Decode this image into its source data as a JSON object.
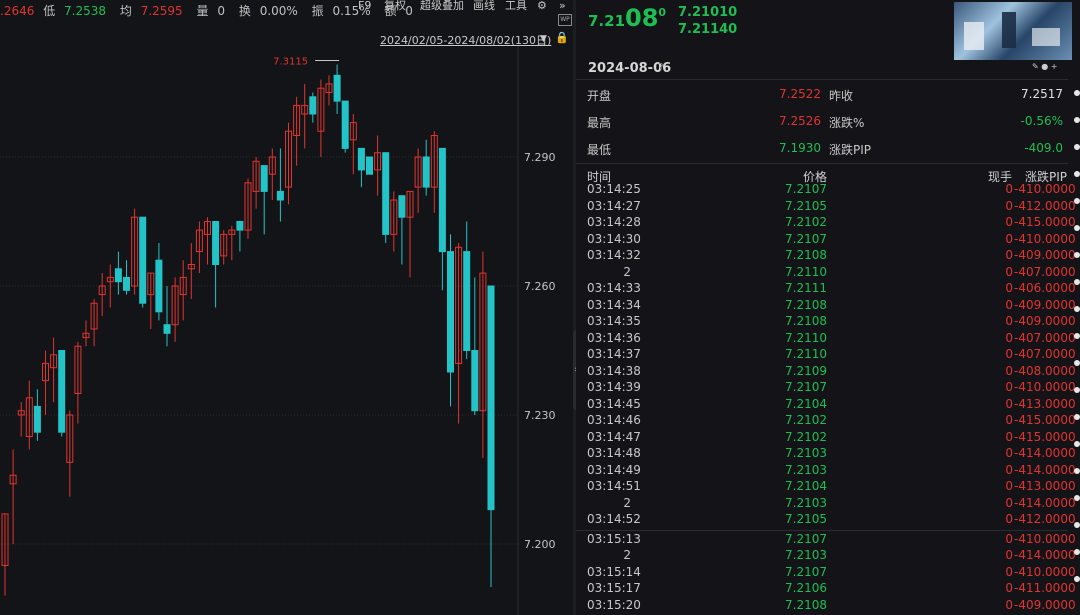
{
  "statbar": {
    "close_tail": ".2646",
    "low_label": "低",
    "low_value": "7.2538",
    "avg_label": "均",
    "avg_value": "7.2595",
    "vol_label": "量",
    "vol_value": "0",
    "turnover_label": "换",
    "turnover_value": "0.00%",
    "amplitude_label": "振",
    "amplitude_value": "0.15%",
    "amount_label": "额",
    "amount_value": "0"
  },
  "toolbar": {
    "f9": "F9",
    "restore": "复权",
    "overlay": "超级叠加",
    "drawline": "画线",
    "tools": "工具",
    "icon_badge": "WP"
  },
  "chart_header": {
    "range": "2024/02/05-2024/08/02(130日)"
  },
  "chart_data": {
    "type": "candlestick",
    "y_axis_ticks": [
      "7.290",
      "7.260",
      "7.230",
      "7.200"
    ],
    "y_tick_values": [
      7.29,
      7.26,
      7.23,
      7.2
    ],
    "max_annotation": "7.3115",
    "max_value": 7.3115,
    "colors": {
      "up": "#e0342f",
      "down": "#22c4c8",
      "grid": "#2a2c33"
    },
    "candles": [
      {
        "o": 7.195,
        "h": 7.205,
        "l": 7.188,
        "c": 7.207
      },
      {
        "o": 7.214,
        "h": 7.222,
        "l": 7.2,
        "c": 7.216
      },
      {
        "o": 7.23,
        "h": 7.233,
        "l": 7.225,
        "c": 7.231
      },
      {
        "o": 7.225,
        "h": 7.238,
        "l": 7.222,
        "c": 7.234
      },
      {
        "o": 7.232,
        "h": 7.236,
        "l": 7.224,
        "c": 7.226
      },
      {
        "o": 7.238,
        "h": 7.245,
        "l": 7.23,
        "c": 7.242
      },
      {
        "o": 7.241,
        "h": 7.248,
        "l": 7.233,
        "c": 7.244
      },
      {
        "o": 7.245,
        "h": 7.24,
        "l": 7.225,
        "c": 7.226
      },
      {
        "o": 7.219,
        "h": 7.231,
        "l": 7.211,
        "c": 7.23
      },
      {
        "o": 7.235,
        "h": 7.247,
        "l": 7.228,
        "c": 7.246
      },
      {
        "o": 7.248,
        "h": 7.252,
        "l": 7.246,
        "c": 7.249
      },
      {
        "o": 7.25,
        "h": 7.257,
        "l": 7.246,
        "c": 7.256
      },
      {
        "o": 7.258,
        "h": 7.263,
        "l": 7.253,
        "c": 7.26
      },
      {
        "o": 7.261,
        "h": 7.265,
        "l": 7.255,
        "c": 7.262
      },
      {
        "o": 7.264,
        "h": 7.268,
        "l": 7.258,
        "c": 7.261
      },
      {
        "o": 7.262,
        "h": 7.266,
        "l": 7.258,
        "c": 7.259
      },
      {
        "o": 7.26,
        "h": 7.278,
        "l": 7.258,
        "c": 7.276
      },
      {
        "o": 7.276,
        "h": 7.27,
        "l": 7.255,
        "c": 7.256
      },
      {
        "o": 7.258,
        "h": 7.262,
        "l": 7.25,
        "c": 7.263
      },
      {
        "o": 7.266,
        "h": 7.27,
        "l": 7.252,
        "c": 7.254
      },
      {
        "o": 7.251,
        "h": 7.26,
        "l": 7.246,
        "c": 7.249
      },
      {
        "o": 7.251,
        "h": 7.262,
        "l": 7.247,
        "c": 7.26
      },
      {
        "o": 7.258,
        "h": 7.266,
        "l": 7.252,
        "c": 7.262
      },
      {
        "o": 7.264,
        "h": 7.27,
        "l": 7.257,
        "c": 7.265
      },
      {
        "o": 7.268,
        "h": 7.275,
        "l": 7.263,
        "c": 7.273
      },
      {
        "o": 7.272,
        "h": 7.276,
        "l": 7.265,
        "c": 7.275
      },
      {
        "o": 7.275,
        "h": 7.266,
        "l": 7.255,
        "c": 7.265
      },
      {
        "o": 7.267,
        "h": 7.273,
        "l": 7.265,
        "c": 7.272
      },
      {
        "o": 7.272,
        "h": 7.274,
        "l": 7.266,
        "c": 7.273
      },
      {
        "o": 7.275,
        "h": 7.274,
        "l": 7.268,
        "c": 7.273
      },
      {
        "o": 7.273,
        "h": 7.285,
        "l": 7.271,
        "c": 7.284
      },
      {
        "o": 7.282,
        "h": 7.29,
        "l": 7.278,
        "c": 7.289
      },
      {
        "o": 7.288,
        "h": 7.281,
        "l": 7.272,
        "c": 7.282
      },
      {
        "o": 7.286,
        "h": 7.292,
        "l": 7.28,
        "c": 7.29
      },
      {
        "o": 7.282,
        "h": 7.292,
        "l": 7.275,
        "c": 7.28
      },
      {
        "o": 7.283,
        "h": 7.298,
        "l": 7.279,
        "c": 7.296
      },
      {
        "o": 7.295,
        "h": 7.304,
        "l": 7.288,
        "c": 7.302
      },
      {
        "o": 7.3,
        "h": 7.307,
        "l": 7.292,
        "c": 7.302
      },
      {
        "o": 7.304,
        "h": 7.305,
        "l": 7.298,
        "c": 7.3
      },
      {
        "o": 7.296,
        "h": 7.308,
        "l": 7.29,
        "c": 7.306
      },
      {
        "o": 7.305,
        "h": 7.309,
        "l": 7.302,
        "c": 7.307
      },
      {
        "o": 7.309,
        "h": 7.3115,
        "l": 7.3,
        "c": 7.303
      },
      {
        "o": 7.303,
        "h": 7.3,
        "l": 7.291,
        "c": 7.292
      },
      {
        "o": 7.294,
        "h": 7.3,
        "l": 7.286,
        "c": 7.298
      },
      {
        "o": 7.292,
        "h": 7.29,
        "l": 7.283,
        "c": 7.287
      },
      {
        "o": 7.29,
        "h": 7.288,
        "l": 7.286,
        "c": 7.286
      },
      {
        "o": 7.287,
        "h": 7.295,
        "l": 7.281,
        "c": 7.291
      },
      {
        "o": 7.291,
        "h": 7.29,
        "l": 7.27,
        "c": 7.272
      },
      {
        "o": 7.272,
        "h": 7.282,
        "l": 7.268,
        "c": 7.28
      },
      {
        "o": 7.281,
        "h": 7.278,
        "l": 7.265,
        "c": 7.276
      },
      {
        "o": 7.276,
        "h": 7.28,
        "l": 7.262,
        "c": 7.282
      },
      {
        "o": 7.283,
        "h": 7.292,
        "l": 7.277,
        "c": 7.29
      },
      {
        "o": 7.29,
        "h": 7.294,
        "l": 7.281,
        "c": 7.283
      },
      {
        "o": 7.283,
        "h": 7.296,
        "l": 7.277,
        "c": 7.295
      },
      {
        "o": 7.292,
        "h": 7.288,
        "l": 7.259,
        "c": 7.268
      },
      {
        "o": 7.268,
        "h": 7.272,
        "l": 7.232,
        "c": 7.24
      },
      {
        "o": 7.242,
        "h": 7.27,
        "l": 7.228,
        "c": 7.269
      },
      {
        "o": 7.268,
        "h": 7.275,
        "l": 7.243,
        "c": 7.245
      },
      {
        "o": 7.245,
        "h": 7.262,
        "l": 7.23,
        "c": 7.231
      },
      {
        "o": 7.231,
        "h": 7.268,
        "l": 7.22,
        "c": 7.263
      },
      {
        "o": 7.26,
        "h": 7.252,
        "l": 7.19,
        "c": 7.208
      }
    ]
  },
  "quote": {
    "price_prefix": "7.21",
    "price_big": "08",
    "price_sup": "0",
    "bid": "7.21010",
    "ask": "7.21140",
    "date": "2024-08-06",
    "help": "?",
    "open_label": "开盘",
    "open_value": "7.2522",
    "prev_close_label": "昨收",
    "prev_close_value": "7.2517",
    "high_label": "最高",
    "high_value": "7.2526",
    "change_pct_label": "涨跌%",
    "change_pct_value": "-0.56%",
    "low_label": "最低",
    "low_value": "7.1930",
    "change_pip_label": "涨跌PIP",
    "change_pip_value": "-409.0"
  },
  "trades": {
    "headers": {
      "time": "时间",
      "price": "价格",
      "vol": "现手",
      "change": "涨跌PIP"
    },
    "rows_a": [
      {
        "time": "03:14:25",
        "price": "7.2107",
        "vol": "0",
        "chg": "-410.0000"
      },
      {
        "time": "03:14:27",
        "price": "7.2105",
        "vol": "0",
        "chg": "-412.0000"
      },
      {
        "time": "03:14:28",
        "price": "7.2102",
        "vol": "0",
        "chg": "-415.0000"
      },
      {
        "time": "03:14:30",
        "price": "7.2107",
        "vol": "0",
        "chg": "-410.0000"
      },
      {
        "time": "03:14:32",
        "price": "7.2108",
        "vol": "0",
        "chg": "-409.0000"
      },
      {
        "time": "2",
        "price": "7.2110",
        "vol": "0",
        "chg": "-407.0000"
      },
      {
        "time": "03:14:33",
        "price": "7.2111",
        "vol": "0",
        "chg": "-406.0000"
      },
      {
        "time": "03:14:34",
        "price": "7.2108",
        "vol": "0",
        "chg": "-409.0000"
      },
      {
        "time": "03:14:35",
        "price": "7.2108",
        "vol": "0",
        "chg": "-409.0000"
      },
      {
        "time": "03:14:36",
        "price": "7.2110",
        "vol": "0",
        "chg": "-407.0000"
      },
      {
        "time": "03:14:37",
        "price": "7.2110",
        "vol": "0",
        "chg": "-407.0000"
      },
      {
        "time": "03:14:38",
        "price": "7.2109",
        "vol": "0",
        "chg": "-408.0000"
      },
      {
        "time": "03:14:39",
        "price": "7.2107",
        "vol": "0",
        "chg": "-410.0000"
      },
      {
        "time": "03:14:45",
        "price": "7.2104",
        "vol": "0",
        "chg": "-413.0000"
      },
      {
        "time": "03:14:46",
        "price": "7.2102",
        "vol": "0",
        "chg": "-415.0000"
      },
      {
        "time": "03:14:47",
        "price": "7.2102",
        "vol": "0",
        "chg": "-415.0000"
      },
      {
        "time": "03:14:48",
        "price": "7.2103",
        "vol": "0",
        "chg": "-414.0000"
      },
      {
        "time": "03:14:49",
        "price": "7.2103",
        "vol": "0",
        "chg": "-414.0000"
      },
      {
        "time": "03:14:51",
        "price": "7.2104",
        "vol": "0",
        "chg": "-413.0000"
      },
      {
        "time": "2",
        "price": "7.2103",
        "vol": "0",
        "chg": "-414.0000"
      },
      {
        "time": "03:14:52",
        "price": "7.2105",
        "vol": "0",
        "chg": "-412.0000"
      }
    ],
    "rows_b": [
      {
        "time": "03:15:13",
        "price": "7.2107",
        "vol": "0",
        "chg": "-410.0000"
      },
      {
        "time": "2",
        "price": "7.2103",
        "vol": "0",
        "chg": "-414.0000"
      },
      {
        "time": "03:15:14",
        "price": "7.2107",
        "vol": "0",
        "chg": "-410.0000"
      },
      {
        "time": "03:15:17",
        "price": "7.2106",
        "vol": "0",
        "chg": "-411.0000"
      },
      {
        "time": "03:15:20",
        "price": "7.2108",
        "vol": "0",
        "chg": "-409.0000"
      }
    ]
  }
}
